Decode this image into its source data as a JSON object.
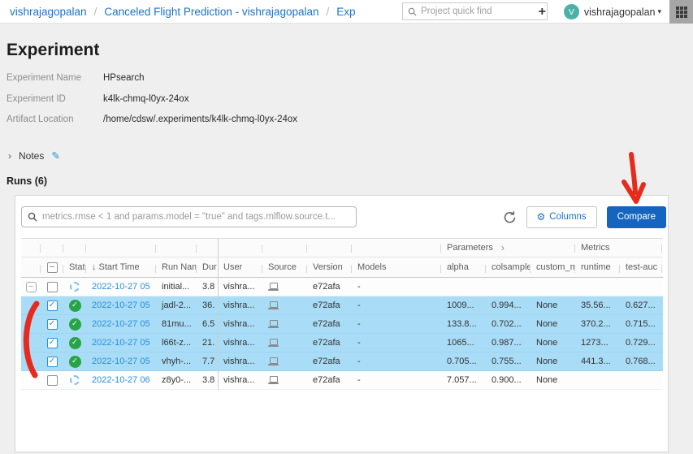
{
  "topbar": {
    "breadcrumbs": [
      "vishrajagopalan",
      "Canceled Flight Prediction - vishrajagopalan",
      "Exp"
    ],
    "separator": "/",
    "quick_find_placeholder": "Project quick find",
    "avatar_initial": "V",
    "user_name": "vishrajagopalan"
  },
  "experiment": {
    "title": "Experiment",
    "fields": [
      {
        "label": "Experiment Name",
        "value": "HPsearch"
      },
      {
        "label": "Experiment ID",
        "value": "k4lk-chmq-l0yx-24ox"
      },
      {
        "label": "Artifact Location",
        "value": "/home/cdsw/.experiments/k4lk-chmq-l0yx-24ox"
      }
    ],
    "notes_label": "Notes",
    "runs_heading": "Runs (6)"
  },
  "toolbar": {
    "filter_placeholder": "metrics.rmse < 1 and params.model = \"true\" and tags.mlflow.source.t...",
    "columns_label": "Columns",
    "compare_label": "Compare"
  },
  "table": {
    "groups": {
      "parameters": "Parameters",
      "metrics": "Metrics"
    },
    "headers": {
      "status": "Stat",
      "start_time": "Start Time",
      "run_name": "Run Name",
      "duration": "Dur",
      "user": "User",
      "source": "Source",
      "version": "Version",
      "models": "Models",
      "alpha": "alpha",
      "colsample": "colsample",
      "custom_metric": "custom_m",
      "runtime": "runtime",
      "test_auc": "test-auc"
    },
    "rows": [
      {
        "expander": true,
        "checked": false,
        "selected": false,
        "status": "running",
        "start_time": "2022-10-27 05",
        "run_name": "initial...",
        "duration": "3.8",
        "user": "vishra...",
        "version": "e72afa",
        "models": "-",
        "alpha": "",
        "colsample": "",
        "custom_metric": "",
        "runtime": "",
        "test_auc": ""
      },
      {
        "expander": false,
        "checked": true,
        "selected": true,
        "status": "success",
        "start_time": "2022-10-27 05",
        "run_name": "jadl-2...",
        "duration": "36.",
        "user": "vishra...",
        "version": "e72afa",
        "models": "-",
        "alpha": "1009...",
        "colsample": "0.994...",
        "custom_metric": "None",
        "runtime": "35.56...",
        "test_auc": "0.627..."
      },
      {
        "expander": false,
        "checked": true,
        "selected": true,
        "status": "success",
        "start_time": "2022-10-27 05",
        "run_name": "81mu...",
        "duration": "6.5",
        "user": "vishra...",
        "version": "e72afa",
        "models": "-",
        "alpha": "133.8...",
        "colsample": "0.702...",
        "custom_metric": "None",
        "runtime": "370.2...",
        "test_auc": "0.715..."
      },
      {
        "expander": false,
        "checked": true,
        "selected": true,
        "status": "success",
        "start_time": "2022-10-27 05",
        "run_name": "l66t-z...",
        "duration": "21.",
        "user": "vishra...",
        "version": "e72afa",
        "models": "-",
        "alpha": "1065...",
        "colsample": "0.987...",
        "custom_metric": "None",
        "runtime": "1273...",
        "test_auc": "0.729..."
      },
      {
        "expander": false,
        "checked": true,
        "selected": true,
        "status": "success",
        "start_time": "2022-10-27 05",
        "run_name": "vhyh-...",
        "duration": "7.7",
        "user": "vishra...",
        "version": "e72afa",
        "models": "-",
        "alpha": "0.705...",
        "colsample": "0.755...",
        "custom_metric": "None",
        "runtime": "441.3...",
        "test_auc": "0.768..."
      },
      {
        "expander": false,
        "checked": false,
        "selected": false,
        "status": "running",
        "start_time": "2022-10-27 06",
        "run_name": "z8y0-...",
        "duration": "3.8",
        "user": "vishra...",
        "version": "e72afa",
        "models": "-",
        "alpha": "7.057...",
        "colsample": "0.900...",
        "custom_metric": "None",
        "runtime": "",
        "test_auc": ""
      }
    ]
  },
  "icons": {
    "plus": "+",
    "caret_down": "▾",
    "notes_chevron": "›",
    "edit_pencil": "✎",
    "gear": "⚙",
    "sort_desc": "↓",
    "params_chevron": "›",
    "indeterminate": "–",
    "expander_collapse": "–",
    "checkmark": "✓"
  },
  "colors": {
    "breadcrumb_blue": "#1a73c9",
    "table_link_blue": "#2a90dd",
    "compare_button_blue": "#1565c0",
    "selected_row_blue": "#a9dcf6",
    "success_green": "#27a348",
    "annotation_red": "#e62b1e",
    "avatar_teal": "#4db0a8"
  }
}
